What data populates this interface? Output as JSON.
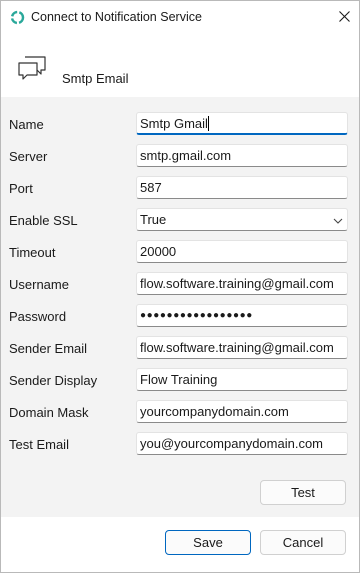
{
  "window": {
    "title": "Connect to Notification Service",
    "icon": "refresh-cycle-icon",
    "close_icon": "close-icon"
  },
  "header": {
    "icon": "chat-bubbles-icon",
    "title": "Smtp Email"
  },
  "form": {
    "fields": [
      {
        "label": "Name",
        "value": "Smtp Gmail"
      },
      {
        "label": "Server",
        "value": "smtp.gmail.com"
      },
      {
        "label": "Port",
        "value": "587"
      },
      {
        "label": "Enable SSL",
        "value": "True"
      },
      {
        "label": "Timeout",
        "value": "20000"
      },
      {
        "label": "Username",
        "value": "flow.software.training@gmail.com"
      },
      {
        "label": "Password",
        "value": "●●●●●●●●●●●●●●●●●"
      },
      {
        "label": "Sender Email",
        "value": "flow.software.training@gmail.com"
      },
      {
        "label": "Sender Display",
        "value": "Flow Training"
      },
      {
        "label": "Domain Mask",
        "value": "yourcompanydomain.com"
      },
      {
        "label": "Test Email",
        "value": "you@yourcompanydomain.com"
      }
    ],
    "test_label": "Test"
  },
  "footer": {
    "save_label": "Save",
    "cancel_label": "Cancel"
  },
  "colors": {
    "accent": "#0067c0",
    "icon_teal": "#2aa89a",
    "background": "#f3f3f3"
  }
}
